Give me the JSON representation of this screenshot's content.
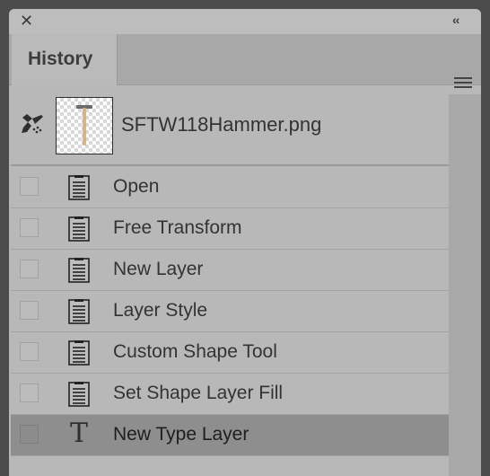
{
  "panel": {
    "tab_label": "History",
    "close_icon": "close-icon",
    "collapse_icon": "double-chevron-left-icon",
    "menu_icon": "hamburger-menu-icon"
  },
  "snapshot": {
    "icon": "history-brush-icon",
    "label": "SFTW118Hammer.png"
  },
  "history_items": [
    {
      "label": "Open",
      "icon": "document-icon",
      "selected": false
    },
    {
      "label": "Free Transform",
      "icon": "document-icon",
      "selected": false
    },
    {
      "label": "New Layer",
      "icon": "document-icon",
      "selected": false
    },
    {
      "label": "Layer Style",
      "icon": "document-icon",
      "selected": false
    },
    {
      "label": "Custom Shape Tool",
      "icon": "document-icon",
      "selected": false
    },
    {
      "label": "Set Shape Layer Fill",
      "icon": "document-icon",
      "selected": false
    },
    {
      "label": "New Type Layer",
      "icon": "type-tool-icon",
      "selected": true
    }
  ],
  "colors": {
    "panel_bg": "#b9b9b9",
    "selected_row": "#8e8e8e",
    "outer_bg": "#4b4b4b"
  }
}
